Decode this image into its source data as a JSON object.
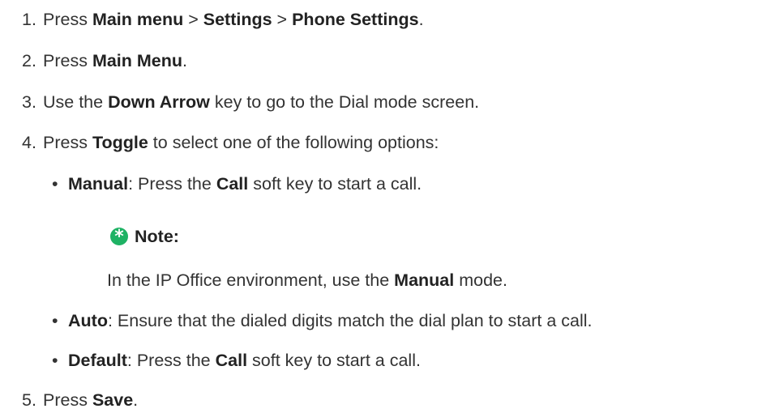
{
  "steps": [
    {
      "num": "1.",
      "parts": [
        "Press ",
        "Main menu",
        " > ",
        "Settings",
        " > ",
        "Phone Settings",
        "."
      ]
    },
    {
      "num": "2.",
      "parts": [
        "Press ",
        "Main Menu",
        "."
      ]
    },
    {
      "num": "3.",
      "parts": [
        "Use the ",
        "Down Arrow",
        " key to go to the Dial mode screen."
      ]
    },
    {
      "num": "4.",
      "parts": [
        "Press ",
        "Toggle",
        " to select one of the following options:"
      ]
    },
    {
      "num": "5.",
      "parts": [
        "Press ",
        "Save",
        "."
      ]
    }
  ],
  "options": [
    {
      "bullet": "•",
      "label": "Manual",
      "parts": [
        ": Press the ",
        "Call",
        " soft key to start a call."
      ]
    },
    {
      "bullet": "•",
      "label": "Auto",
      "parts": [
        ": Ensure that the dialed digits match the dial plan to start a call."
      ]
    },
    {
      "bullet": "•",
      "label": "Default",
      "parts": [
        ": Press the ",
        "Call",
        " soft key to start a call."
      ]
    }
  ],
  "note": {
    "icon": "asterisk-note-icon",
    "icon_glyph": "*",
    "icon_color": "#1eb264",
    "title": "Note:",
    "text_parts": [
      "In the IP Office environment, use the ",
      "Manual",
      " mode."
    ]
  }
}
